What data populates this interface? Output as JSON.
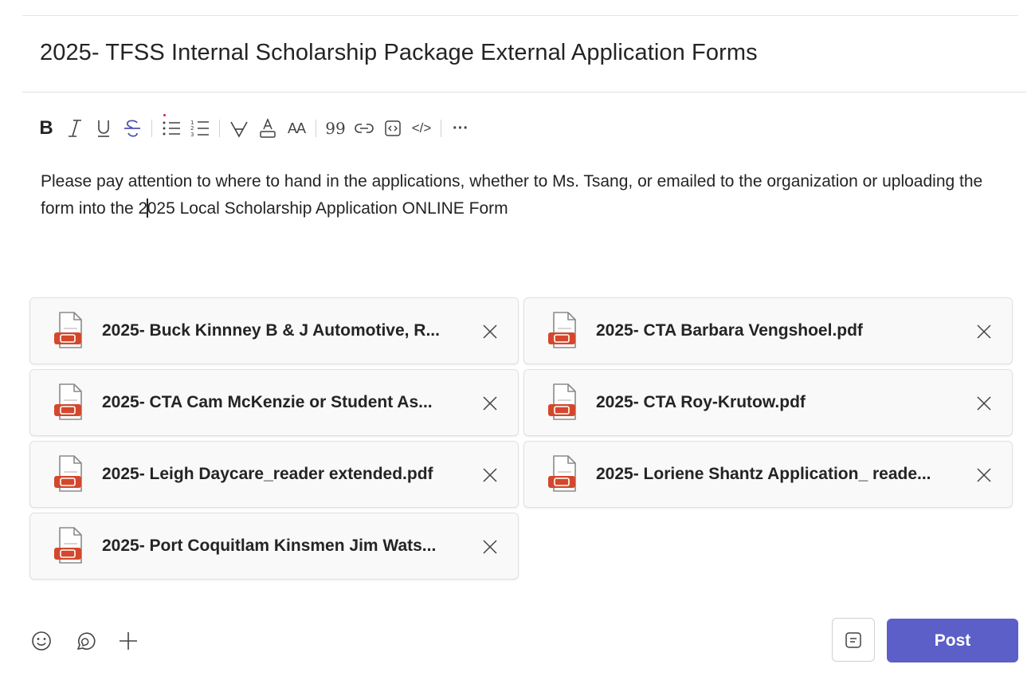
{
  "subject": "2025- TFSS Internal Scholarship Package External Application Forms",
  "toolbar": {
    "items": [
      {
        "icon": "bold-icon",
        "label": "B"
      },
      {
        "icon": "italic-icon"
      },
      {
        "icon": "underline-icon"
      },
      {
        "icon": "strikethrough-icon"
      },
      {
        "icon": "bulleted-list-icon"
      },
      {
        "icon": "numbered-list-icon"
      },
      {
        "icon": "highlight-icon"
      },
      {
        "icon": "font-color-icon"
      },
      {
        "icon": "font-size-icon",
        "label": "AA"
      },
      {
        "icon": "quote-icon",
        "label": "99"
      },
      {
        "icon": "link-icon"
      },
      {
        "icon": "code-snippet-icon"
      },
      {
        "icon": "code-icon",
        "label": "</>"
      },
      {
        "icon": "more-options-icon",
        "label": "···"
      }
    ],
    "accent_color": "#5b5fc7",
    "strikethrough_color": "#4f52b2"
  },
  "message": {
    "before_caret": "Please pay attention to where to hand in the applications, whether to Ms. Tsang, or emailed to the organization or uploading the form into the 2",
    "after_caret": "025 Local Scholarship Application ONLINE Form"
  },
  "attachments": [
    {
      "name": "2025- Buck Kinnney B & J Automotive, R...",
      "icon": "pdf-file-icon"
    },
    {
      "name": "2025- CTA Barbara Vengshoel.pdf",
      "icon": "pdf-file-icon"
    },
    {
      "name": "2025- CTA Cam McKenzie or Student As...",
      "icon": "pdf-file-icon"
    },
    {
      "name": "2025- CTA Roy-Krutow.pdf",
      "icon": "pdf-file-icon"
    },
    {
      "name": "2025- Leigh Daycare_reader extended.pdf",
      "icon": "pdf-file-icon"
    },
    {
      "name": "2025- Loriene Shantz Application_ reade...",
      "icon": "pdf-file-icon"
    },
    {
      "name": "2025- Port Coquitlam Kinsmen Jim Wats...",
      "icon": "pdf-file-icon"
    }
  ],
  "bottom_bar": {
    "icons": [
      "emoji-icon",
      "loop-component-icon",
      "plus-icon",
      "format-icon"
    ],
    "post_label": "Post",
    "post_color": "#5b5fc7"
  },
  "colors": {
    "pdf_red": "#d3482c",
    "text": "#242424"
  }
}
